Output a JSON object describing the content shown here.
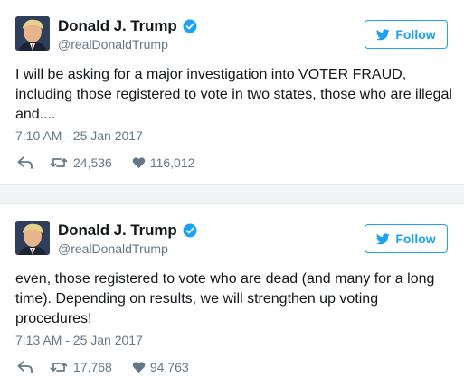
{
  "colors": {
    "accent": "#1da1f2",
    "text": "#14171a",
    "muted": "#657786",
    "verified": "#1da1f2"
  },
  "tweets": [
    {
      "display_name": "Donald J. Trump",
      "handle": "@realDonaldTrump",
      "follow_label": "Follow",
      "text": "I will be asking for a major investigation into VOTER FRAUD, including those registered to vote in two states, those who are illegal and....",
      "timestamp": "7:10 AM - 25 Jan 2017",
      "retweets": "24,536",
      "likes": "116,012",
      "icons": [
        "verified-icon",
        "bird-icon",
        "reply-icon",
        "retweet-icon",
        "heart-icon"
      ]
    },
    {
      "display_name": "Donald J. Trump",
      "handle": "@realDonaldTrump",
      "follow_label": "Follow",
      "text": "even, those registered to vote who are dead (and many for a long time). Depending on results, we will strengthen up voting procedures!",
      "timestamp": "7:13 AM - 25 Jan 2017",
      "retweets": "17,768",
      "likes": "94,763",
      "icons": [
        "verified-icon",
        "bird-icon",
        "reply-icon",
        "retweet-icon",
        "heart-icon"
      ]
    }
  ]
}
